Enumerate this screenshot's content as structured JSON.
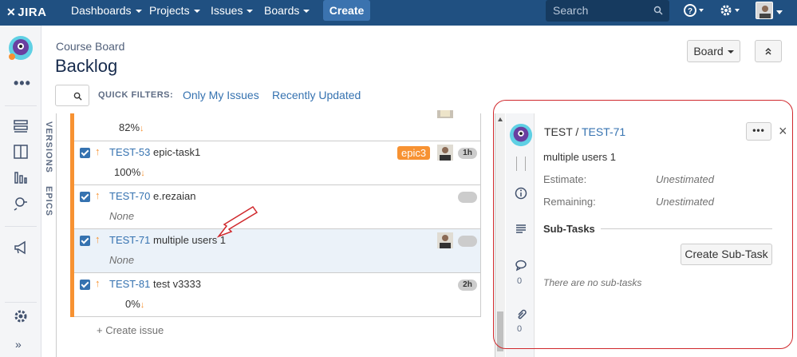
{
  "topnav": {
    "logo": "JIRA",
    "items": [
      {
        "label": "Dashboards"
      },
      {
        "label": "Projects"
      },
      {
        "label": "Issues"
      },
      {
        "label": "Boards"
      }
    ],
    "create_label": "Create",
    "search_placeholder": "Search"
  },
  "header": {
    "breadcrumb": "Course Board",
    "title": "Backlog",
    "board_button": "Board",
    "collapse_symbol": "≈"
  },
  "quick_filters": {
    "label": "QUICK FILTERS:",
    "filters": [
      "Only My Issues",
      "Recently Updated"
    ]
  },
  "vertical_tabs": [
    "VERSIONS",
    "EPICS"
  ],
  "issues": [
    {
      "key": "",
      "summary": "",
      "progress": "82%",
      "progress_arrow": "↓"
    },
    {
      "key": "TEST-53",
      "summary": "epic-task1",
      "epic": "epic3",
      "estimate": "1h",
      "progress": "100%",
      "progress_arrow": "↓"
    },
    {
      "key": "TEST-70",
      "summary": "e.rezaian",
      "estimate": "",
      "sub": "None"
    },
    {
      "key": "TEST-71",
      "summary": "multiple users 1",
      "estimate": "",
      "sub": "None"
    },
    {
      "key": "TEST-81",
      "summary": "test v3333",
      "estimate": "2h",
      "progress": "0%",
      "progress_arrow": "↓"
    }
  ],
  "create_issue": "+ Create issue",
  "detail": {
    "project": "TEST",
    "separator": "/",
    "key": "TEST-71",
    "more": "•••",
    "close": "×",
    "summary": "multiple users 1",
    "fields": [
      {
        "label": "Estimate:",
        "value": "Unestimated"
      },
      {
        "label": "Remaining:",
        "value": "Unestimated"
      }
    ],
    "subtasks_heading": "Sub-Tasks",
    "create_subtask": "Create Sub-Task",
    "no_subtasks": "There are no sub-tasks",
    "comment_count": "0",
    "attachment_count": "0"
  },
  "colors": {
    "nav_bg": "#205081",
    "link": "#3572b0",
    "epic_orange": "#f79232",
    "annotation_red": "#d0282c"
  }
}
